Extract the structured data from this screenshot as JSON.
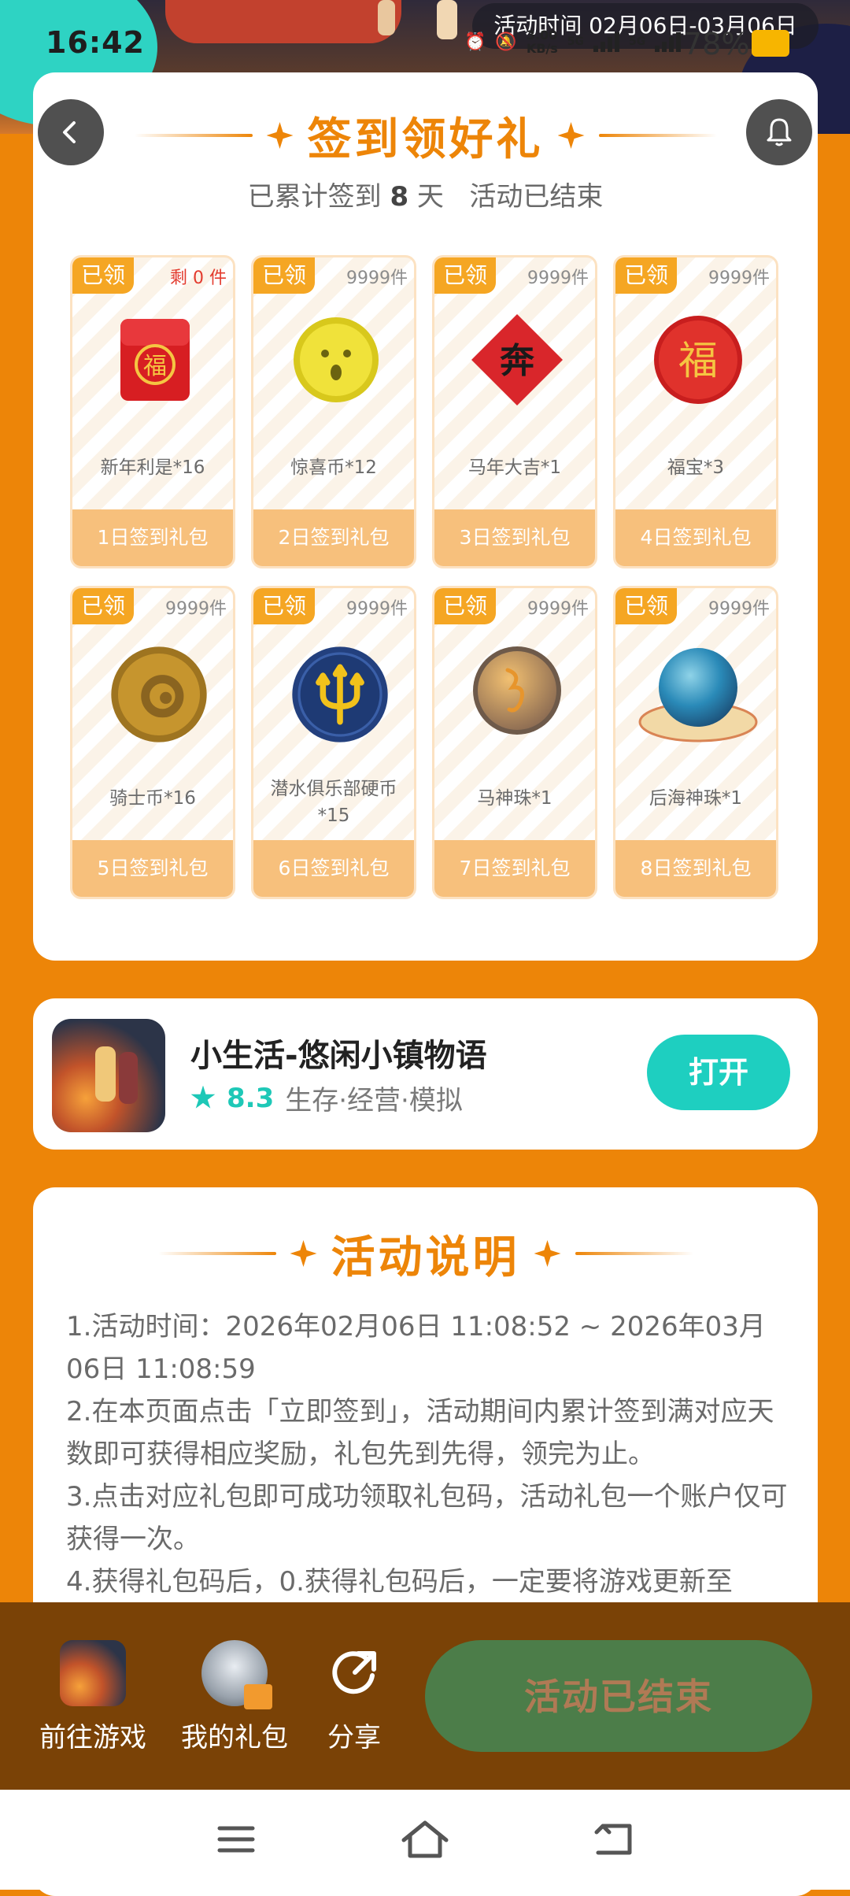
{
  "status_bar": {
    "time": "16:42",
    "net_speed_value": "3.00",
    "net_speed_unit": "KB/s",
    "network_1": "5G",
    "network_2": "5G",
    "battery": "78%"
  },
  "event_period": "活动时间 02月06日-03月06日",
  "signin": {
    "title": "签到领好礼",
    "summary_prefix": "已累计签到",
    "days": "8",
    "summary_suffix": "天",
    "status": "活动已结束",
    "gifts": [
      {
        "badge": "已领",
        "stock": "剩 0 件",
        "name": "新年利是*16",
        "footer": "1日签到礼包",
        "icon": "red-envelope-icon"
      },
      {
        "badge": "已领",
        "stock": "9999件",
        "name": "惊喜币*12",
        "footer": "2日签到礼包",
        "icon": "surprise-coin-icon"
      },
      {
        "badge": "已领",
        "stock": "9999件",
        "name": "马年大吉*1",
        "footer": "3日签到礼包",
        "icon": "horse-year-icon"
      },
      {
        "badge": "已领",
        "stock": "9999件",
        "name": "福宝*3",
        "footer": "4日签到礼包",
        "icon": "fu-treasure-icon"
      },
      {
        "badge": "已领",
        "stock": "9999件",
        "name": "骑士币*16",
        "footer": "5日签到礼包",
        "icon": "knight-coin-icon"
      },
      {
        "badge": "已领",
        "stock": "9999件",
        "name": "潜水俱乐部硬币*15",
        "footer": "6日签到礼包",
        "icon": "diving-club-coin-icon"
      },
      {
        "badge": "已领",
        "stock": "9999件",
        "name": "马神珠*1",
        "footer": "7日签到礼包",
        "icon": "horse-god-pearl-icon"
      },
      {
        "badge": "已领",
        "stock": "9999件",
        "name": "后海神珠*1",
        "footer": "8日签到礼包",
        "icon": "sea-god-pearl-icon"
      }
    ],
    "fu_char": "福",
    "horse_char": "奔"
  },
  "app": {
    "name": "小生活-悠闲小镇物语",
    "rating": "8.3",
    "tags": "生存·经营·模拟",
    "open_label": "打开"
  },
  "rules": {
    "title": "活动说明",
    "lines": [
      "1.活动时间：2026年02月06日 11:08:52 ~ 2026年03月06日 11:08:59",
      "2.在本页面点击「立即签到」，活动期间内累计签到满对应天数即可获得相应奖励，礼包先到先得，领完为止。",
      "3.点击对应礼包即可成功领取礼包码，活动礼包一个账户仅可获得一次。",
      "4.获得礼包码后，0.获得礼包码后，一定要将游戏更新至"
    ]
  },
  "bottom_bar": {
    "go_game": "前往游戏",
    "my_gifts": "我的礼包",
    "share": "分享",
    "ended": "活动已结束"
  },
  "colors": {
    "accent_orange": "#ED8508",
    "badge_orange": "#F5A623",
    "footer_peach": "#F7C07C",
    "teal": "#1ECFC0",
    "ended_green": "#4C7D49",
    "bottom_brown": "#7A4206"
  }
}
